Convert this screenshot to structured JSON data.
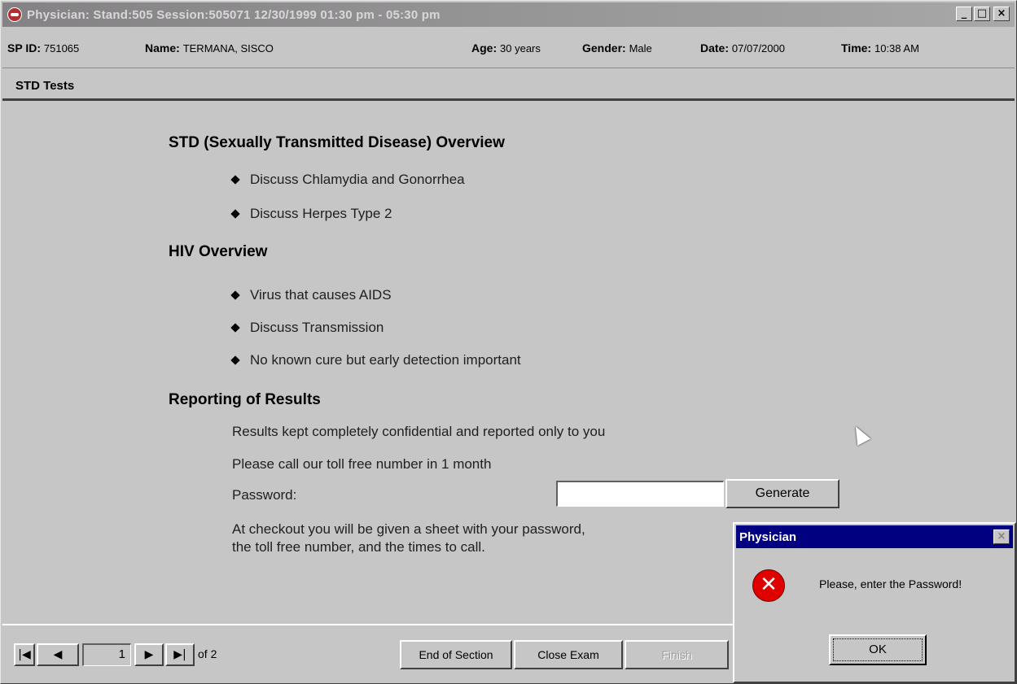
{
  "window": {
    "title": "Physician: Stand:505 Session:505071 12/30/1999 01:30 pm - 05:30 pm",
    "controls": {
      "minimize": "_",
      "maximize": "□",
      "close": "×"
    }
  },
  "patient": {
    "sp_id_label": "SP ID:",
    "sp_id": "751065",
    "name_label": "Name:",
    "name": "TERMANA, SISCO",
    "age_label": "Age:",
    "age": "30 years",
    "gender_label": "Gender:",
    "gender": "Male",
    "date_label": "Date:",
    "date": "07/07/2000",
    "time_label": "Time:",
    "time": "10:38 AM"
  },
  "section": {
    "title": "STD Tests"
  },
  "content": {
    "std_heading": "STD (Sexually Transmitted Disease) Overview",
    "std_items": [
      "Discuss Chlamydia and Gonorrhea",
      "Discuss Herpes Type 2"
    ],
    "hiv_heading": "HIV Overview",
    "hiv_items": [
      "Virus that causes AIDS",
      "Discuss Transmission",
      "No known cure but early detection important"
    ],
    "reporting_heading": "Reporting of Results",
    "reporting_line1": "Results kept completely confidential and reported only to you",
    "reporting_line2": "Please call our toll free number in 1 month",
    "password_label": "Password:",
    "password_value": "",
    "generate_label": "Generate",
    "checkout_line1": "At checkout you will be given a sheet with your password,",
    "checkout_line2": "the toll free number, and the times to call."
  },
  "navigation": {
    "first": "|◀",
    "prev": "◀",
    "next": "▶",
    "last": "▶|",
    "current_page": "1",
    "of_text": "of 2",
    "end_section_label": "End of Section",
    "close_exam_label": "Close Exam",
    "finish_label": "Finish"
  },
  "dialog": {
    "title": "Physician",
    "close": "×",
    "icon": "error-icon",
    "icon_glyph": "✕",
    "message": "Please, enter the Password!",
    "ok_label": "OK"
  }
}
